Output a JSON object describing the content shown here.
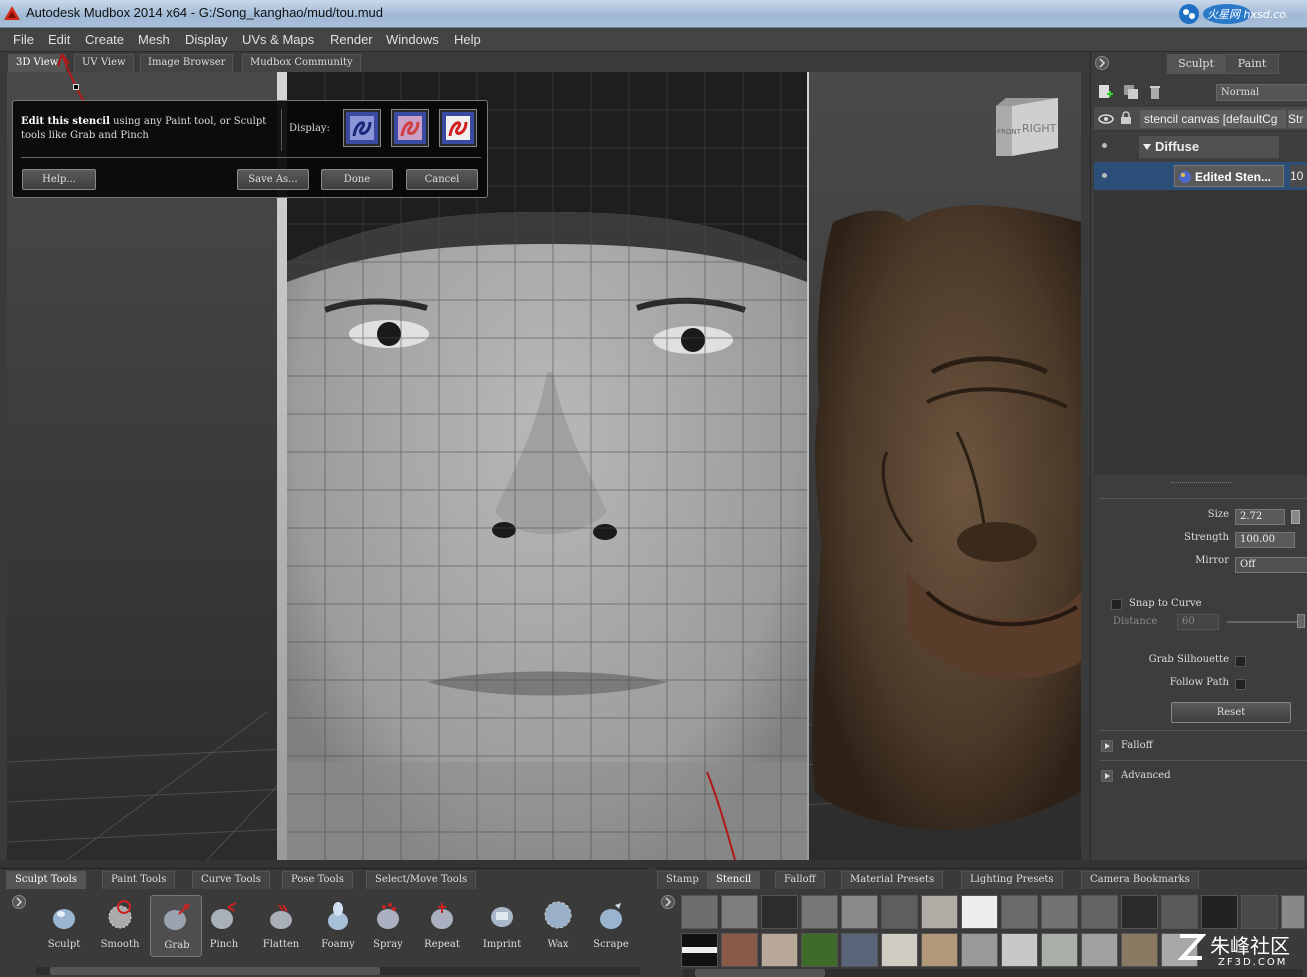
{
  "window": {
    "title": "Autodesk Mudbox 2014 x64 - G:/Song_kanghao/mud/tou.mud"
  },
  "menu": [
    "File",
    "Edit",
    "Create",
    "Mesh",
    "Display",
    "UVs & Maps",
    "Render",
    "Windows",
    "Help"
  ],
  "view_tabs": [
    "3D View",
    "UV View",
    "Image Browser",
    "Mudbox Community"
  ],
  "viewcube": {
    "face_front": "FRONT",
    "face_right": "RIGHT"
  },
  "stencil_popup": {
    "message_bold": "Edit this stencil",
    "message_rest": " using any Paint tool, or Sculpt tools like Grab and Pinch",
    "display_label": "Display:",
    "help_button": "Help...",
    "save_as_button": "Save As...",
    "done_button": "Done",
    "cancel_button": "Cancel"
  },
  "right_panel": {
    "mode_tabs": [
      "Sculpt",
      "Paint"
    ],
    "blend_mode": "Normal",
    "layers": {
      "canvas_name": "stencil canvas [defaultCg",
      "canvas_extra": "Str",
      "group_name": "Diffuse",
      "edited_name": "Edited Sten...",
      "edited_value": "10"
    },
    "properties": {
      "size_label": "Size",
      "size_value": "2.72",
      "strength_label": "Strength",
      "strength_value": "100.00",
      "mirror_label": "Mirror",
      "mirror_value": "Off",
      "snap_to_curve_label": "Snap to Curve",
      "distance_label": "Distance",
      "distance_value": "60",
      "grab_silhouette_label": "Grab Silhouette",
      "follow_path_label": "Follow Path",
      "reset_button": "Reset",
      "falloff_section": "Falloff",
      "advanced_section": "Advanced"
    }
  },
  "bottom_tools": {
    "tabs": [
      "Sculpt Tools",
      "Paint Tools",
      "Curve Tools",
      "Pose Tools",
      "Select/Move Tools"
    ],
    "tools": [
      "Sculpt",
      "Smooth",
      "Grab",
      "Pinch",
      "Flatten",
      "Foamy",
      "Spray",
      "Repeat",
      "Imprint",
      "Wax",
      "Scrape"
    ],
    "selected_tool": "Grab"
  },
  "bottom_trays": {
    "tabs": [
      "Stamp",
      "Stencil",
      "Falloff",
      "Material Presets",
      "Lighting Presets",
      "Camera Bookmarks"
    ],
    "active_tab": "Stencil"
  },
  "watermarks": {
    "top_right": "火星网 hxsd.com",
    "bottom_right_cn": "朱峰社区",
    "bottom_right_en": "ZF3D.COM"
  },
  "colors": {
    "annotation_arrow": "#b01818",
    "selection_blue": "#2b4f79",
    "panel_bg": "#3d3d3d"
  }
}
